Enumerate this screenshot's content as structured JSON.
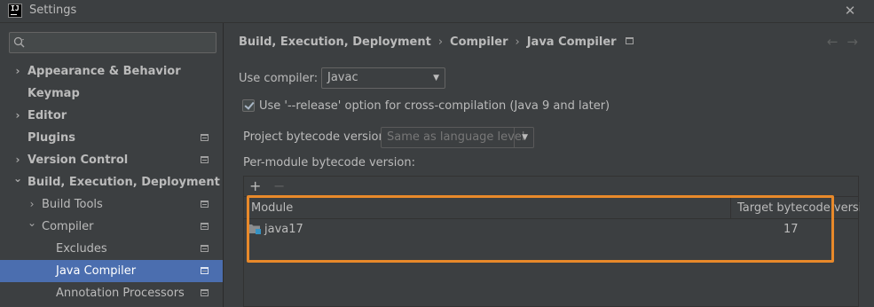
{
  "window": {
    "title": "Settings",
    "app_logo_text": "IJ",
    "close_glyph": "✕"
  },
  "sidebar": {
    "search": {
      "value": "",
      "placeholder": ""
    },
    "items": [
      {
        "label": "Appearance & Behavior",
        "arrow": "›",
        "bold": true
      },
      {
        "label": "Keymap",
        "arrow": "",
        "bold": true
      },
      {
        "label": "Editor",
        "arrow": "›",
        "bold": true
      },
      {
        "label": "Plugins",
        "arrow": "",
        "bold": true
      },
      {
        "label": "Version Control",
        "arrow": "›",
        "bold": true
      },
      {
        "label": "Build, Execution, Deployment",
        "arrow": "⌄",
        "bold": true
      },
      {
        "label": "Build Tools",
        "arrow": "›",
        "bold": false
      },
      {
        "label": "Compiler",
        "arrow": "⌄",
        "bold": false
      },
      {
        "label": "Excludes",
        "arrow": "",
        "bold": false
      },
      {
        "label": "Java Compiler",
        "arrow": "",
        "bold": false,
        "selected": true
      },
      {
        "label": "Annotation Processors",
        "arrow": "",
        "bold": false
      }
    ]
  },
  "breadcrumb": {
    "items": [
      "Build, Execution, Deployment",
      "Compiler",
      "Java Compiler"
    ],
    "separator": "›"
  },
  "nav": {
    "back": "←",
    "forward": "→"
  },
  "form": {
    "use_compiler_label": "Use compiler:",
    "use_compiler_value": "Javac",
    "release_option_label": "Use '--release' option for cross-compilation (Java 9 and later)",
    "release_option_checked": true,
    "project_bytecode_label": "Project bytecode version:",
    "project_bytecode_placeholder": "Same as language level",
    "per_module_label": "Per-module bytecode version:"
  },
  "table": {
    "toolbar": {
      "add": "+",
      "remove": "−"
    },
    "columns": [
      "Module",
      "Target bytecode version"
    ],
    "rows": [
      {
        "module": "java17",
        "target": "17"
      }
    ]
  },
  "colors": {
    "background": "#3c3f41",
    "selection": "#4b6eaf",
    "highlight": "#e8892a",
    "text": "#bbbbbb"
  },
  "icons": {
    "search": "search-icon",
    "project_level": "project-level-icon",
    "folder": "module-folder-icon",
    "dropdown": "chevron-down-icon"
  }
}
